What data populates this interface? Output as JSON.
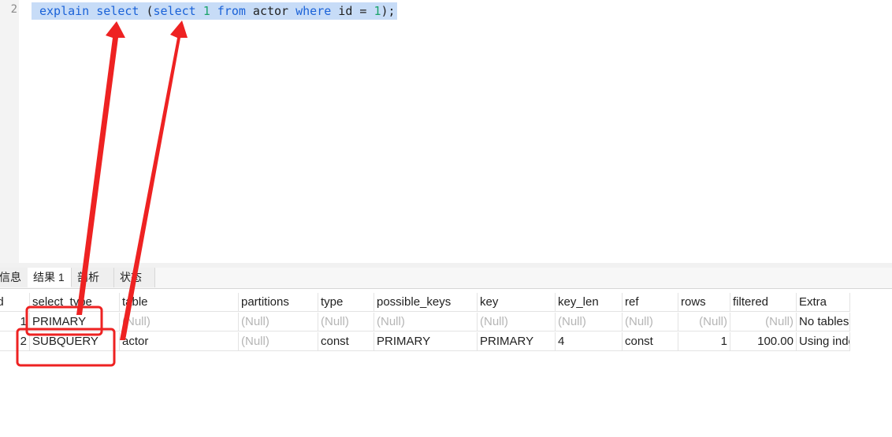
{
  "editor": {
    "line_number": "2",
    "code": [
      {
        "t": "explain",
        "c": "kw"
      },
      {
        "t": " ",
        "c": ""
      },
      {
        "t": "select",
        "c": "kw"
      },
      {
        "t": " (",
        "c": ""
      },
      {
        "t": "select",
        "c": "kw"
      },
      {
        "t": " ",
        "c": ""
      },
      {
        "t": "1",
        "c": "num"
      },
      {
        "t": " ",
        "c": ""
      },
      {
        "t": "from",
        "c": "kw"
      },
      {
        "t": " actor ",
        "c": ""
      },
      {
        "t": "where",
        "c": "kw"
      },
      {
        "t": " id = ",
        "c": ""
      },
      {
        "t": "1",
        "c": "num"
      },
      {
        "t": ");",
        "c": ""
      }
    ]
  },
  "tabs": [
    "信息",
    "结果 1",
    "剖析",
    "状态"
  ],
  "active_tab": 1,
  "result": {
    "columns": [
      "id",
      "select_type",
      "table",
      "partitions",
      "type",
      "possible_keys",
      "key",
      "key_len",
      "ref",
      "rows",
      "filtered",
      "Extra"
    ],
    "rows": [
      [
        "1",
        "PRIMARY",
        "(Null)",
        "(Null)",
        "(Null)",
        "(Null)",
        "(Null)",
        "(Null)",
        "(Null)",
        "(Null)",
        "(Null)",
        "No tables used"
      ],
      [
        "2",
        "SUBQUERY",
        "actor",
        "(Null)",
        "const",
        "PRIMARY",
        "PRIMARY",
        "4",
        "const",
        "1",
        "100.00",
        "Using index"
      ]
    ]
  },
  "colors": {
    "annotation": "#ee2222",
    "selection": "#c7dcf7",
    "keyword": "#1a62d8",
    "number": "#1aa36a"
  }
}
